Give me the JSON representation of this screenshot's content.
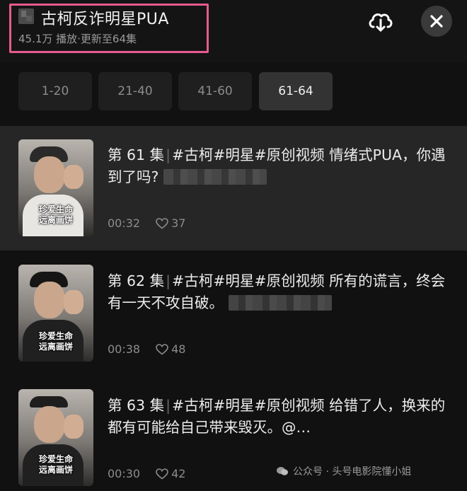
{
  "header": {
    "title": "古柯反诈明星PUA",
    "meta": "45.1万 播放·更新至64集"
  },
  "range_tabs": [
    {
      "label": "1-20",
      "active": false
    },
    {
      "label": "21-40",
      "active": false
    },
    {
      "label": "41-60",
      "active": false
    },
    {
      "label": "61-64",
      "active": true
    }
  ],
  "episodes": [
    {
      "number": "第 61 集",
      "hashtags": "#古柯#明星#原创视频",
      "text": "情绪式PUA，你遇到了吗?",
      "duration": "00:32",
      "likes": "37",
      "thumb_caption_1": "珍爱生命",
      "thumb_caption_2": "远离画饼"
    },
    {
      "number": "第 62 集",
      "hashtags": "#古柯#明星#原创视频",
      "text": "所有的谎言，终会有一天不攻自破。",
      "duration": "00:38",
      "likes": "48",
      "thumb_caption_1": "珍爱生命",
      "thumb_caption_2": "远离画饼"
    },
    {
      "number": "第 63 集",
      "hashtags": "#古柯#明星#原创视频",
      "text": "给错了人，换来的都有可能给自己带来毁灭。@…",
      "duration": "00:30",
      "likes": "42",
      "thumb_caption_1": "珍爱生命",
      "thumb_caption_2": "远离画饼"
    }
  ],
  "watermark": "公众号 · 头号电影院懂小姐",
  "icons": {
    "download": "cloud-download-icon",
    "close": "close-icon",
    "like": "heart-icon"
  },
  "colors": {
    "highlight_box": "#e85a8e",
    "background": "#111111",
    "active_row": "#262626"
  }
}
